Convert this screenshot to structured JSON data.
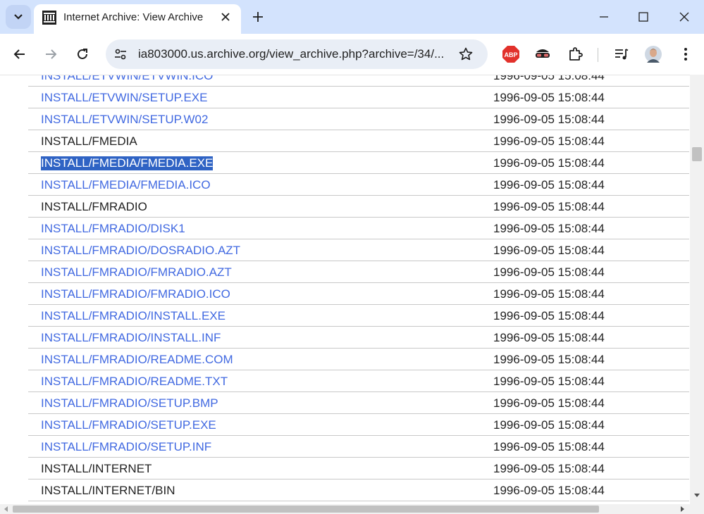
{
  "browser": {
    "tab_title": "Internet Archive: View Archive",
    "url": "ia803000.us.archive.org/view_archive.php?archive=/34/...",
    "accent_color": "#d3e3fd",
    "extensions": [
      "adblock-icon",
      "incognito-mask-icon",
      "puzzle-extensions-icon",
      "media-control-icon",
      "profile-avatar"
    ],
    "adblock_label": "ABP"
  },
  "archive": {
    "partial_top_row": {
      "name": "INSTALL/ETVWIN/ETVWIN.ICO",
      "date": "1996-09-05 15:08:44"
    },
    "rows": [
      {
        "name": "INSTALL/ETVWIN/SETUP.EXE",
        "date": "1996-09-05 15:08:44",
        "link": true
      },
      {
        "name": "INSTALL/ETVWIN/SETUP.W02",
        "date": "1996-09-05 15:08:44",
        "link": true
      },
      {
        "name": "INSTALL/FMEDIA",
        "date": "1996-09-05 15:08:44",
        "link": false
      },
      {
        "name": "INSTALL/FMEDIA/FMEDIA.EXE",
        "date": "1996-09-05 15:08:44",
        "link": true,
        "selected": true
      },
      {
        "name": "INSTALL/FMEDIA/FMEDIA.ICO",
        "date": "1996-09-05 15:08:44",
        "link": true
      },
      {
        "name": "INSTALL/FMRADIO",
        "date": "1996-09-05 15:08:44",
        "link": false
      },
      {
        "name": "INSTALL/FMRADIO/DISK1",
        "date": "1996-09-05 15:08:44",
        "link": true
      },
      {
        "name": "INSTALL/FMRADIO/DOSRADIO.AZT",
        "date": "1996-09-05 15:08:44",
        "link": true
      },
      {
        "name": "INSTALL/FMRADIO/FMRADIO.AZT",
        "date": "1996-09-05 15:08:44",
        "link": true
      },
      {
        "name": "INSTALL/FMRADIO/FMRADIO.ICO",
        "date": "1996-09-05 15:08:44",
        "link": true
      },
      {
        "name": "INSTALL/FMRADIO/INSTALL.EXE",
        "date": "1996-09-05 15:08:44",
        "link": true
      },
      {
        "name": "INSTALL/FMRADIO/INSTALL.INF",
        "date": "1996-09-05 15:08:44",
        "link": true
      },
      {
        "name": "INSTALL/FMRADIO/README.COM",
        "date": "1996-09-05 15:08:44",
        "link": true
      },
      {
        "name": "INSTALL/FMRADIO/README.TXT",
        "date": "1996-09-05 15:08:44",
        "link": true
      },
      {
        "name": "INSTALL/FMRADIO/SETUP.BMP",
        "date": "1996-09-05 15:08:44",
        "link": true
      },
      {
        "name": "INSTALL/FMRADIO/SETUP.EXE",
        "date": "1996-09-05 15:08:44",
        "link": true
      },
      {
        "name": "INSTALL/FMRADIO/SETUP.INF",
        "date": "1996-09-05 15:08:44",
        "link": true
      },
      {
        "name": "INSTALL/INTERNET",
        "date": "1996-09-05 15:08:44",
        "link": false
      },
      {
        "name": "INSTALL/INTERNET/BIN",
        "date": "1996-09-05 15:08:44",
        "link": false
      }
    ],
    "link_color": "#4169e1",
    "selection_color": "#2f63c4"
  }
}
